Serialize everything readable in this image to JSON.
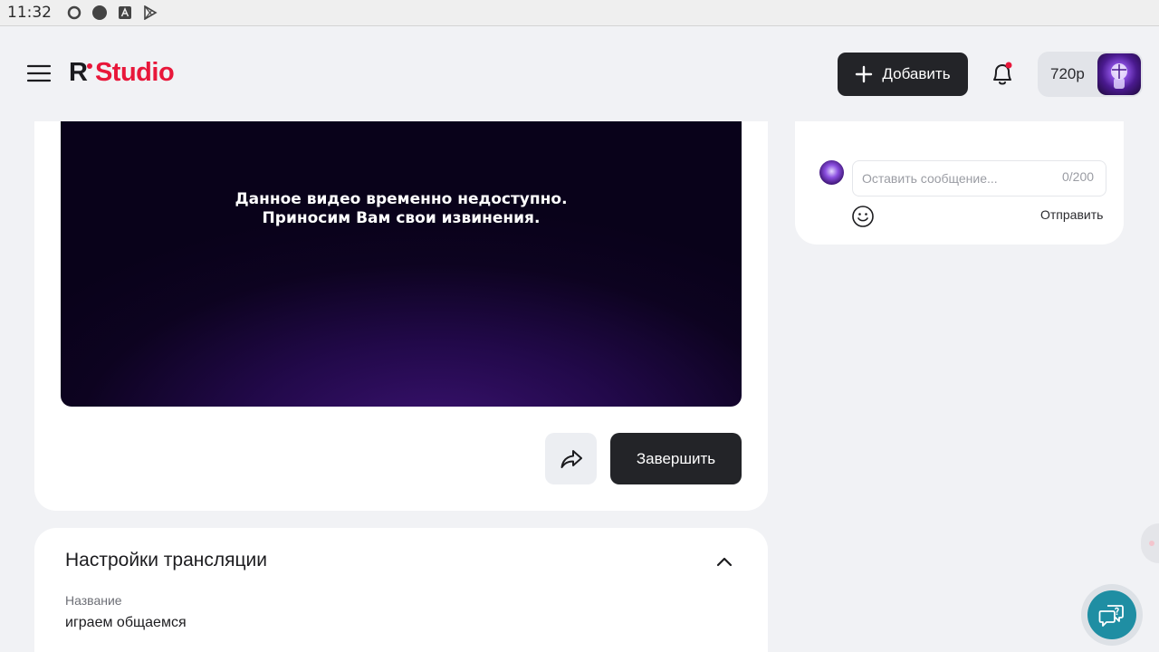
{
  "statusbar": {
    "time": "11:32",
    "icons": [
      "sync-circle-icon",
      "record-dot-icon",
      "text-a-icon",
      "play-store-icon"
    ]
  },
  "header": {
    "logo_r": "R",
    "logo_studio": "Studio",
    "add_label": "Добавить",
    "balance": "720р"
  },
  "video": {
    "message_line1": "Данное видео временно недоступно.",
    "message_line2": "Приносим Вам свои извинения."
  },
  "actions": {
    "finish_label": "Завершить"
  },
  "settings": {
    "title": "Настройки трансляции",
    "name_label": "Название",
    "name_value": "играем общаемся"
  },
  "chat": {
    "placeholder": "Оставить сообщение...",
    "counter": "0/200",
    "send_label": "Отправить"
  },
  "colors": {
    "accent": "#e8173a",
    "dark_button": "#232428",
    "support": "#1f8ea3",
    "background": "#f1f2f5"
  }
}
